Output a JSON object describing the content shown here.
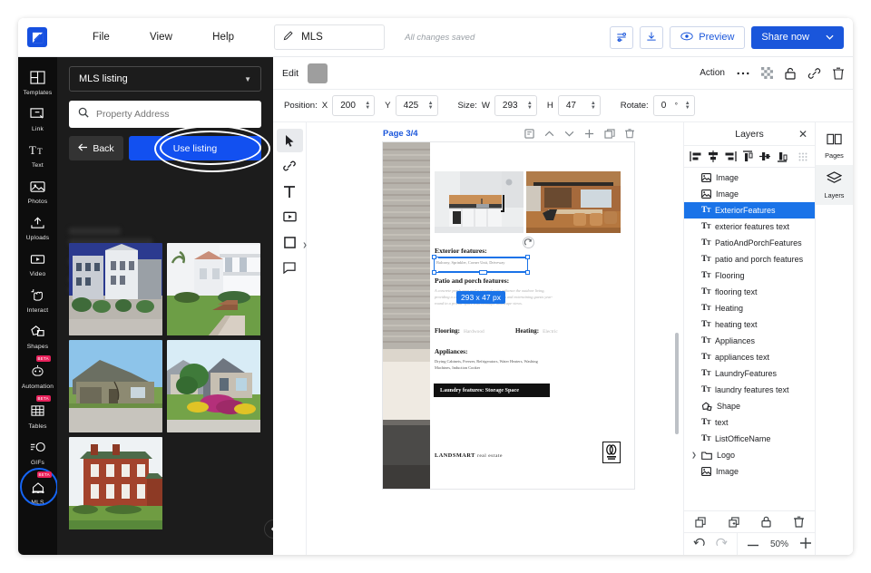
{
  "topbar": {
    "logo": "app-logo",
    "menus": [
      "File",
      "View",
      "Help"
    ],
    "doc_title": "MLS",
    "pencil_icon": "pencil-icon",
    "save_status": "All changes saved",
    "settings_icon": "sliders-icon",
    "download_icon": "download-icon",
    "preview_label": "Preview",
    "preview_icon": "eye-icon",
    "share_label": "Share now",
    "share_caret": "chevron-down-icon"
  },
  "rail": {
    "items": [
      {
        "label": "Templates",
        "icon": "templates-icon",
        "beta": ""
      },
      {
        "label": "Link",
        "icon": "link-icon",
        "beta": ""
      },
      {
        "label": "Text",
        "icon": "text-icon",
        "beta": ""
      },
      {
        "label": "Photos",
        "icon": "photos-icon",
        "beta": ""
      },
      {
        "label": "Uploads",
        "icon": "uploads-icon",
        "beta": ""
      },
      {
        "label": "Video",
        "icon": "video-icon",
        "beta": ""
      },
      {
        "label": "Interact",
        "icon": "interact-icon",
        "beta": ""
      },
      {
        "label": "Shapes",
        "icon": "shapes-icon",
        "beta": ""
      },
      {
        "label": "Automation",
        "icon": "automation-icon",
        "beta": "BETA"
      },
      {
        "label": "Tables",
        "icon": "tables-icon",
        "beta": "BETA"
      },
      {
        "label": "GIFs",
        "icon": "gifs-icon",
        "beta": ""
      },
      {
        "label": "MLS",
        "icon": "mls-home-icon",
        "beta": "BETA"
      }
    ],
    "active": "MLS"
  },
  "leftpanel": {
    "select_value": "MLS listing",
    "select_caret": "chevron-down-icon",
    "search_icon": "search-icon",
    "search_placeholder": "Property Address",
    "search_value": "",
    "back_label": "Back",
    "back_icon": "arrow-left-icon",
    "use_listing_label": "Use listing",
    "collapse_icon": "chevron-left-icon",
    "thumbnails": [
      "victorian-row-houses",
      "white-two-story-house",
      "single-story-ranch-house",
      "stone-house-with-flowers",
      "red-brick-colonial-house"
    ]
  },
  "editbar": {
    "edit_label": "Edit",
    "color_swatch": "#9e9e9e",
    "action_label": "Action",
    "more_icon": "more-horizontal-icon",
    "transparency_icon": "transparency-icon",
    "lock_icon": "lock-icon",
    "link_icon": "link-icon",
    "delete_icon": "trash-icon"
  },
  "properties": {
    "position_label": "Position:",
    "x_label": "X",
    "x_value": "200",
    "y_label": "Y",
    "y_value": "425",
    "size_label": "Size:",
    "w_label": "W",
    "w_value": "293",
    "h_label": "H",
    "h_value": "47",
    "rotate_label": "Rotate:",
    "rotate_value": "0",
    "degree_symbol": "°"
  },
  "canvas_tools": [
    {
      "name": "select-tool",
      "icon": "cursor-icon"
    },
    {
      "name": "link-tool",
      "icon": "link-icon"
    },
    {
      "name": "text-tool",
      "icon": "text-t-icon"
    },
    {
      "name": "video-tool",
      "icon": "video-icon"
    },
    {
      "name": "shape-tool",
      "icon": "square-icon"
    },
    {
      "name": "comment-tool",
      "icon": "comment-icon"
    }
  ],
  "canvas": {
    "page_label": "Page 3/4",
    "actions": [
      "notes-icon",
      "chevron-up-icon",
      "chevron-down-icon",
      "plus-icon",
      "duplicate-icon",
      "trash-icon"
    ],
    "selection_badge": "293 x 47 px",
    "rotate_handle_icon": "rotate-icon"
  },
  "document": {
    "exterior_title": "Exterior features:",
    "exterior_value": "Balcony, Sprinkler, Corner Unit, Driveway",
    "patio_title": "Patio and porch features:",
    "patio_value": "A concrete porch area and a covered patio enhance the outdoor living, providing a comfortable setting for relaxation and entertaining guests year-round in a private space with beautiful landscape views.",
    "flooring_label": "Flooring:",
    "flooring_value": "Hardwood",
    "heating_label": "Heating:",
    "heating_value": "Electric",
    "appliances_title": "Appliances:",
    "appliances_value": "Drying Cabinets, Freezer, Refrigerators, Water Heaters, Washing Machines, Induction Cooker",
    "laundry_chip": "Laundry features: Storage Space",
    "footer_brand_bold": "LANDSMART",
    "footer_brand_rest": "real estate",
    "footer_logo": "office-logo"
  },
  "layers": {
    "title": "Layers",
    "close_icon": "close-icon",
    "align_tools": [
      "align-left-icon",
      "align-center-horizontal-icon",
      "align-right-icon",
      "align-top-icon",
      "align-middle-vertical-icon",
      "align-bottom-icon",
      "grid-handle-icon"
    ],
    "items": [
      {
        "label": "Image",
        "type": "image",
        "selected": false,
        "expandable": false
      },
      {
        "label": "Image",
        "type": "image",
        "selected": false,
        "expandable": false
      },
      {
        "label": "ExteriorFeatures",
        "type": "text",
        "selected": true,
        "expandable": false
      },
      {
        "label": "exterior features text",
        "type": "text",
        "selected": false,
        "expandable": false
      },
      {
        "label": "PatioAndPorchFeatures",
        "type": "text",
        "selected": false,
        "expandable": false
      },
      {
        "label": "patio and porch features",
        "type": "text",
        "selected": false,
        "expandable": false
      },
      {
        "label": "Flooring",
        "type": "text",
        "selected": false,
        "expandable": false
      },
      {
        "label": "flooring text",
        "type": "text",
        "selected": false,
        "expandable": false
      },
      {
        "label": "Heating",
        "type": "text",
        "selected": false,
        "expandable": false
      },
      {
        "label": "heating text",
        "type": "text",
        "selected": false,
        "expandable": false
      },
      {
        "label": "Appliances",
        "type": "text",
        "selected": false,
        "expandable": false
      },
      {
        "label": "appliances text",
        "type": "text",
        "selected": false,
        "expandable": false
      },
      {
        "label": "LaundryFeatures",
        "type": "text",
        "selected": false,
        "expandable": false
      },
      {
        "label": "laundry features text",
        "type": "text",
        "selected": false,
        "expandable": false
      },
      {
        "label": "Shape",
        "type": "shape",
        "selected": false,
        "expandable": false
      },
      {
        "label": "text",
        "type": "text",
        "selected": false,
        "expandable": false
      },
      {
        "label": "ListOfficeName",
        "type": "text",
        "selected": false,
        "expandable": false
      },
      {
        "label": "Logo",
        "type": "folder",
        "selected": false,
        "expandable": true
      },
      {
        "label": "Image",
        "type": "image",
        "selected": false,
        "expandable": false
      }
    ],
    "footer_tools": [
      "copy-icon",
      "duplicate-icon",
      "lock-icon",
      "trash-icon"
    ],
    "undo_icon": "undo-icon",
    "redo_icon": "redo-icon",
    "zoom_out_icon": "minus-icon",
    "zoom_level": "50%",
    "zoom_in_icon": "plus-icon"
  },
  "right_rail": [
    {
      "label": "Pages",
      "icon": "pages-icon",
      "active": false
    },
    {
      "label": "Layers",
      "icon": "layers-icon",
      "active": true
    }
  ],
  "colors": {
    "accent": "#1a56db",
    "blue_button": "#1250f0",
    "selection": "#1a73e8",
    "dark_panel": "#1c1c1c",
    "rail_bg": "#0d0d0d",
    "beta_badge": "#e8215b"
  }
}
